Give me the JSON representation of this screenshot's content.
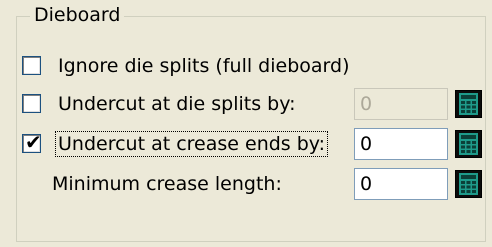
{
  "group": {
    "title": "Dieboard"
  },
  "options": [
    {
      "label": "Ignore die splits (full dieboard)",
      "checked": false
    },
    {
      "label": "Undercut at die splits by:",
      "checked": false,
      "value": "0",
      "enabled": false
    },
    {
      "label": "Undercut at crease ends by:",
      "checked": true,
      "value": "0",
      "enabled": true,
      "focused": true
    },
    {
      "label": "Minimum crease length:",
      "value": "0",
      "enabled": true
    }
  ],
  "checkmark_glyph": "✔",
  "icons": {
    "calculator": "calculator-icon"
  },
  "colors": {
    "background": "#ece9d8",
    "calculator_green": "#1e9a8a",
    "field_border": "#7f9db9",
    "disabled_text": "#aca899"
  }
}
